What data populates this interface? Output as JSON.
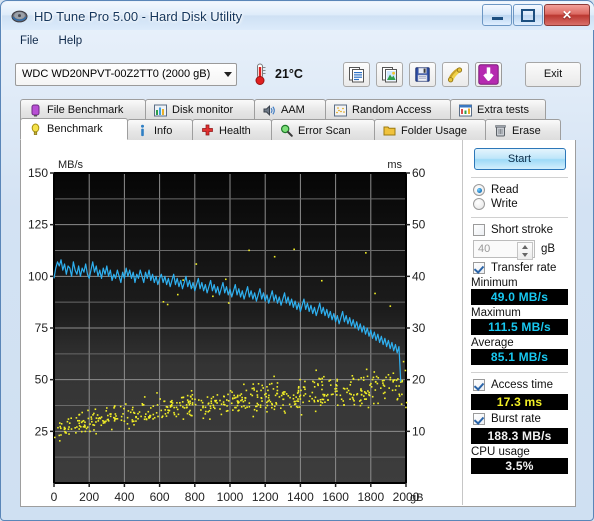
{
  "window": {
    "title": "HD Tune Pro 5.00 - Hard Disk Utility",
    "minimize_label": "",
    "maximize_label": "",
    "close_label": "✕"
  },
  "menu": [
    {
      "label": "File"
    },
    {
      "label": "Help"
    }
  ],
  "toolbar": {
    "drive": "WDC WD20NPVT-00Z2TT0 (2000 gB)",
    "temperature": "21°C",
    "exit_label": "Exit",
    "icons": [
      {
        "name": "copy-text-icon"
      },
      {
        "name": "copy-image-icon"
      },
      {
        "name": "save-icon"
      },
      {
        "name": "plug-icon"
      },
      {
        "name": "download-icon"
      }
    ]
  },
  "tabs_row1": [
    {
      "label": "File Benchmark",
      "icon": "file-benchmark-icon",
      "active": false
    },
    {
      "label": "Disk monitor",
      "icon": "disk-monitor-icon",
      "active": false
    },
    {
      "label": "AAM",
      "icon": "speaker-icon",
      "active": false
    },
    {
      "label": "Random Access",
      "icon": "random-access-icon",
      "active": false
    },
    {
      "label": "Extra tests",
      "icon": "extra-tests-icon",
      "active": false
    }
  ],
  "tabs_row2": [
    {
      "label": "Benchmark",
      "icon": "benchmark-icon",
      "active": true
    },
    {
      "label": "Info",
      "icon": "info-icon",
      "active": false
    },
    {
      "label": "Health",
      "icon": "health-icon",
      "active": false
    },
    {
      "label": "Error Scan",
      "icon": "error-scan-icon",
      "active": false
    },
    {
      "label": "Folder Usage",
      "icon": "folder-usage-icon",
      "active": false
    },
    {
      "label": "Erase",
      "icon": "erase-icon",
      "active": false
    }
  ],
  "sidebar": {
    "start_label": "Start",
    "mode_read": "Read",
    "mode_write": "Write",
    "mode_selected": "Read",
    "short_stroke_label": "Short stroke",
    "short_stroke_checked": false,
    "short_stroke_value": "40",
    "short_stroke_unit": "gB",
    "transfer_rate_label": "Transfer rate",
    "transfer_rate_checked": true,
    "minimum_label": "Minimum",
    "minimum_value": "49.0 MB/s",
    "maximum_label": "Maximum",
    "maximum_value": "111.5 MB/s",
    "average_label": "Average",
    "average_value": "85.1 MB/s",
    "access_time_label": "Access time",
    "access_time_checked": true,
    "access_time_value": "17.3 ms",
    "burst_rate_label": "Burst rate",
    "burst_rate_checked": true,
    "burst_rate_value": "188.3 MB/s",
    "cpu_usage_label": "CPU usage",
    "cpu_usage_value": "3.5%"
  },
  "chart_data": {
    "type": "line",
    "title": "",
    "ylabel": "MB/s",
    "y2label": "ms",
    "xlabel": "gB",
    "xlim": [
      0,
      2000
    ],
    "ylim": [
      0,
      150
    ],
    "y2lim": [
      0,
      60
    ],
    "xticks": [
      0,
      200,
      400,
      600,
      800,
      1000,
      1200,
      1400,
      1600,
      1800,
      2000
    ],
    "xticklabels": [
      "0",
      "200",
      "400",
      "600",
      "800",
      "1000",
      "1200",
      "1400",
      "1600",
      "1800",
      "2000"
    ],
    "yticks": [
      25,
      50,
      75,
      100,
      125,
      150
    ],
    "yticklabels": [
      "25",
      "50",
      "75",
      "100",
      "125",
      "150"
    ],
    "y2ticks": [
      10,
      20,
      30,
      40,
      50,
      60
    ],
    "y2ticklabels": [
      "10",
      "20",
      "30",
      "40",
      "50",
      "60"
    ],
    "grid": true,
    "series": [
      {
        "name": "Transfer rate",
        "color": "#2eb0f0",
        "axis": "left",
        "unit": "MB/s",
        "x": [
          0,
          10,
          20,
          30,
          40,
          50,
          60,
          70,
          80,
          90,
          100,
          110,
          120,
          130,
          140,
          150,
          160,
          170,
          180,
          190,
          200,
          210,
          220,
          230,
          240,
          250,
          260,
          270,
          280,
          290,
          300,
          310,
          320,
          330,
          340,
          350,
          360,
          370,
          380,
          390,
          400,
          410,
          420,
          430,
          440,
          450,
          460,
          470,
          480,
          490,
          500,
          510,
          520,
          530,
          540,
          550,
          560,
          570,
          580,
          590,
          600,
          610,
          620,
          630,
          640,
          650,
          660,
          670,
          680,
          690,
          700,
          710,
          720,
          730,
          740,
          750,
          760,
          770,
          780,
          790,
          800,
          810,
          820,
          830,
          840,
          850,
          860,
          870,
          880,
          890,
          900,
          910,
          920,
          930,
          940,
          950,
          960,
          970,
          980,
          990,
          1000,
          1010,
          1020,
          1030,
          1040,
          1050,
          1060,
          1070,
          1080,
          1090,
          1100,
          1110,
          1120,
          1130,
          1140,
          1150,
          1160,
          1170,
          1180,
          1190,
          1200,
          1210,
          1220,
          1230,
          1240,
          1250,
          1260,
          1270,
          1280,
          1290,
          1300,
          1310,
          1320,
          1330,
          1340,
          1350,
          1360,
          1370,
          1380,
          1390,
          1400,
          1410,
          1420,
          1430,
          1440,
          1450,
          1460,
          1470,
          1480,
          1490,
          1500,
          1510,
          1520,
          1530,
          1540,
          1550,
          1560,
          1570,
          1580,
          1590,
          1600,
          1610,
          1620,
          1630,
          1640,
          1650,
          1660,
          1670,
          1680,
          1690,
          1700,
          1710,
          1720,
          1730,
          1740,
          1750,
          1760,
          1770,
          1780,
          1790,
          1800,
          1810,
          1820,
          1830,
          1840,
          1850,
          1860,
          1870,
          1880,
          1890,
          1900,
          1910,
          1920,
          1930,
          1940,
          1950,
          1960,
          1970,
          1980,
          1990,
          2000
        ],
        "y": [
          99,
          104,
          107,
          105,
          108,
          103,
          106,
          101,
          105,
          104,
          100,
          107,
          103,
          101,
          105,
          100,
          104,
          102,
          106,
          101,
          99,
          103,
          107,
          102,
          105,
          100,
          103,
          99,
          104,
          101,
          105,
          100,
          103,
          98,
          101,
          99,
          103,
          100,
          97,
          102,
          99,
          104,
          100,
          103,
          99,
          102,
          97,
          101,
          99,
          103,
          100,
          97,
          102,
          99,
          103,
          98,
          101,
          97,
          100,
          96,
          99,
          101,
          97,
          100,
          96,
          99,
          95,
          98,
          101,
          96,
          99,
          95,
          98,
          94,
          97,
          100,
          95,
          98,
          94,
          97,
          93,
          96,
          99,
          94,
          97,
          93,
          96,
          92,
          95,
          98,
          93,
          96,
          92,
          95,
          91,
          94,
          97,
          92,
          95,
          91,
          94,
          90,
          93,
          96,
          91,
          94,
          90,
          93,
          89,
          92,
          95,
          90,
          93,
          89,
          92,
          88,
          91,
          94,
          89,
          92,
          88,
          91,
          87,
          90,
          93,
          88,
          91,
          87,
          90,
          86,
          89,
          92,
          87,
          90,
          86,
          89,
          85,
          88,
          84,
          87,
          83,
          86,
          89,
          84,
          87,
          83,
          86,
          82,
          85,
          81,
          84,
          87,
          82,
          85,
          81,
          84,
          80,
          83,
          79,
          82,
          78,
          81,
          77,
          80,
          83,
          78,
          81,
          77,
          80,
          76,
          79,
          75,
          78,
          74,
          77,
          73,
          76,
          72,
          75,
          71,
          74,
          70,
          73,
          69,
          72,
          68,
          71,
          67,
          70,
          66,
          69,
          65,
          68,
          64,
          67,
          63,
          66,
          49
        ]
      },
      {
        "name": "Access time",
        "color": "#f2ef26",
        "axis": "right",
        "unit": "ms",
        "marker": "point",
        "average_ms": 17.3,
        "description": "Scatter of access-time samples, rising from ~9 ms near the start of the disk to ~20 ms toward the end, spread roughly 8-25 ms."
      }
    ]
  }
}
